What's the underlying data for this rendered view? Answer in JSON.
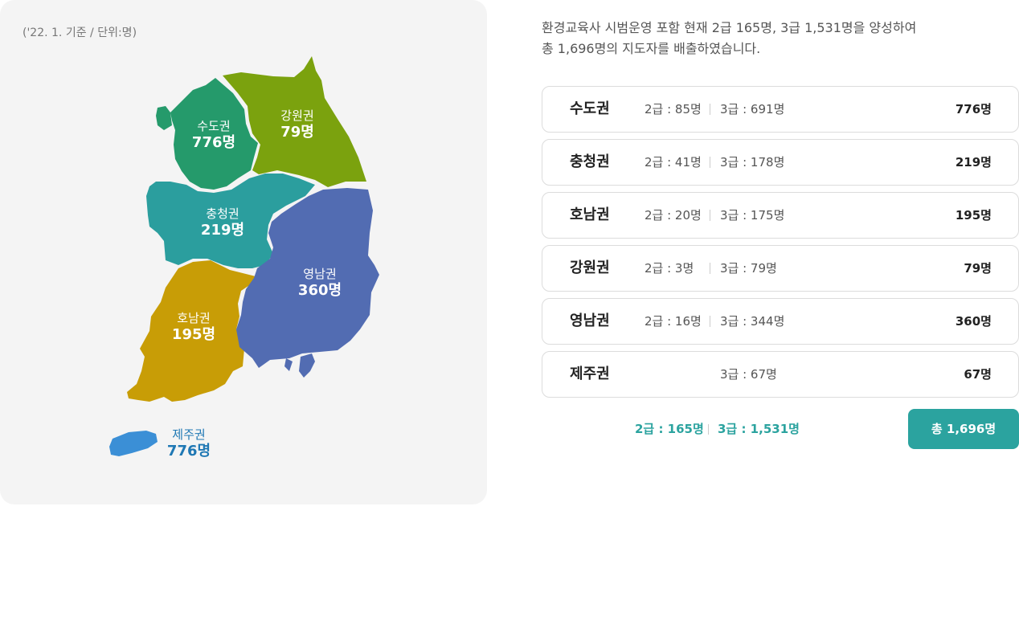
{
  "map": {
    "note": "('22. 1. 기준 / 단위:명)",
    "regions": [
      {
        "key": "sudo",
        "name": "수도권",
        "count": "776명",
        "color": "#259a6b"
      },
      {
        "key": "gangwon",
        "name": "강원권",
        "count": "79명",
        "color": "#7ba20e"
      },
      {
        "key": "chungcheong",
        "name": "충청권",
        "count": "219명",
        "color": "#2b9e9e"
      },
      {
        "key": "honam",
        "name": "호남권",
        "count": "195명",
        "color": "#c89d06"
      },
      {
        "key": "yeongnam",
        "name": "영남권",
        "count": "360명",
        "color": "#526cb2"
      },
      {
        "key": "jeju",
        "name": "제주권",
        "count": "776명",
        "color": "#3b8fd6"
      }
    ]
  },
  "intro": {
    "line1": "환경교육사 시범운영 포함 현재 2급 165명, 3급 1,531명을 양성하여",
    "line2": "총 1,696명의 지도자를 배출하였습니다."
  },
  "table": {
    "rows": [
      {
        "name": "수도권",
        "grade2": "2급 : 85명",
        "grade3": "3급 : 691명",
        "total": "776명"
      },
      {
        "name": "충청권",
        "grade2": "2급 : 41명",
        "grade3": "3급 : 178명",
        "total": "219명"
      },
      {
        "name": "호남권",
        "grade2": "2급 : 20명",
        "grade3": "3급 : 175명",
        "total": "195명"
      },
      {
        "name": "강원권",
        "grade2": "2급 : 3명",
        "grade3": "3급 : 79명",
        "total": "79명"
      },
      {
        "name": "영남권",
        "grade2": "2급 : 16명",
        "grade3": "3급 : 344명",
        "total": "360명"
      },
      {
        "name": "제주권",
        "grade2": "",
        "grade3": "3급 : 67명",
        "total": "67명"
      }
    ],
    "summary": {
      "grade2": "2급 : 165명",
      "grade3": "3급 : 1,531명",
      "grand_total": "총 1,696명"
    }
  },
  "colors": {
    "accent": "#2ba39f",
    "panel_bg": "#f4f4f4"
  }
}
